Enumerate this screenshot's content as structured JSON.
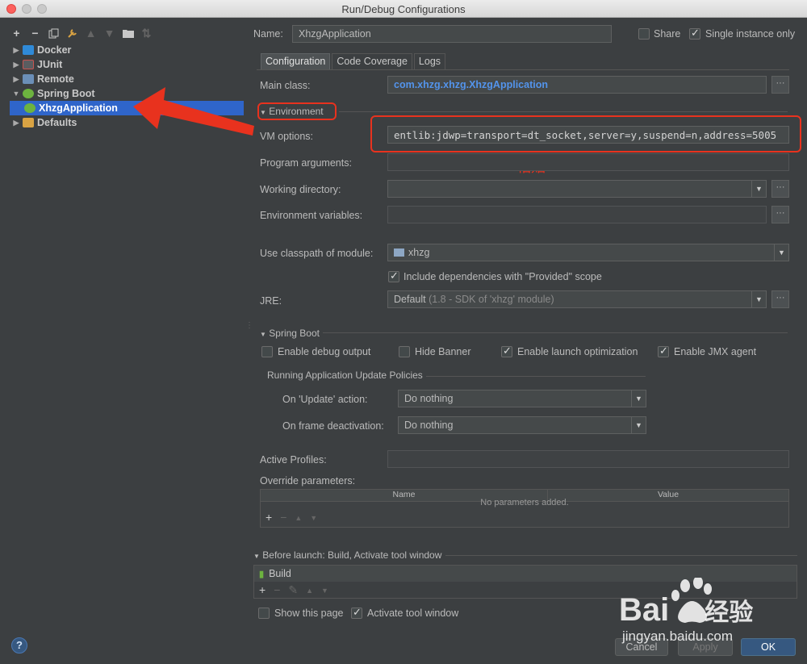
{
  "window": {
    "title": "Run/Debug Configurations"
  },
  "tree": {
    "toolbar_icons": [
      "plus-icon",
      "minus-icon",
      "copy-icon",
      "wrench-icon",
      "arrow-up-icon",
      "arrow-down-icon",
      "folder-icon",
      "sort-icon"
    ],
    "items": [
      {
        "label": "Docker",
        "expanded": false
      },
      {
        "label": "JUnit",
        "expanded": false
      },
      {
        "label": "Remote",
        "expanded": false
      },
      {
        "label": "Spring Boot",
        "expanded": true
      },
      {
        "label": "XhzgApplication",
        "selected": true
      },
      {
        "label": "Defaults",
        "expanded": false
      }
    ]
  },
  "header": {
    "name_label": "Name:",
    "name_value": "XhzgApplication",
    "share_label": "Share",
    "share_checked": false,
    "single_instance_label": "Single instance only",
    "single_instance_checked": true
  },
  "tabs": [
    {
      "label": "Configuration",
      "active": true
    },
    {
      "label": "Code Coverage",
      "active": false
    },
    {
      "label": "Logs",
      "active": false
    }
  ],
  "config": {
    "main_class_label": "Main class:",
    "main_class_value": "com.xhzg.xhzg.XhzgApplication",
    "environment_section": "Environment",
    "vm_options_label": "VM options:",
    "vm_options_value": "entlib:jdwp=transport=dt_socket,server=y,suspend=n,address=5005",
    "paste_note": "粘贴",
    "program_args_label": "Program arguments:",
    "working_dir_label": "Working directory:",
    "env_vars_label": "Environment variables:",
    "classpath_label": "Use classpath of module:",
    "classpath_value": "xhzg",
    "include_deps_label": "Include dependencies with \"Provided\" scope",
    "include_deps_checked": true,
    "jre_label": "JRE:",
    "jre_value": "Default",
    "jre_detail": "(1.8 - SDK of 'xhzg' module)"
  },
  "spring_boot": {
    "section": "Spring Boot",
    "options": [
      {
        "label": "Enable debug output",
        "checked": false
      },
      {
        "label": "Hide Banner",
        "checked": false
      },
      {
        "label": "Enable launch optimization",
        "checked": true
      },
      {
        "label": "Enable JMX agent",
        "checked": true
      }
    ],
    "update_policies_title": "Running Application Update Policies",
    "on_update_label": "On 'Update' action:",
    "on_update_value": "Do nothing",
    "on_frame_label": "On frame deactivation:",
    "on_frame_value": "Do nothing",
    "active_profiles_label": "Active Profiles:",
    "override_label": "Override parameters:",
    "table_headers": [
      "Name",
      "Value"
    ],
    "table_empty": "No parameters added."
  },
  "before_launch": {
    "title": "Before launch: Build, Activate tool window",
    "items": [
      "Build"
    ],
    "show_page_label": "Show this page",
    "show_page_checked": false,
    "activate_label": "Activate tool window",
    "activate_checked": true
  },
  "buttons": {
    "cancel": "Cancel",
    "apply": "Apply",
    "ok": "OK",
    "help": "?"
  },
  "watermark": {
    "brand": "Bai",
    "brand2": "经验",
    "url": "jingyan.baidu.com"
  },
  "colors": {
    "accent": "#2f65ca",
    "annotation": "#e8321e",
    "ok_button": "#365880",
    "main_class": "#5394ec"
  }
}
